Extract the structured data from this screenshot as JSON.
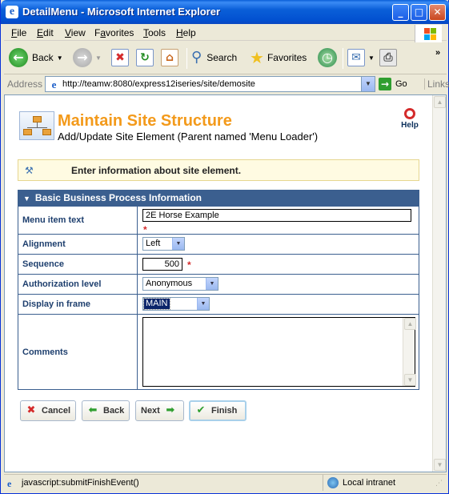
{
  "window": {
    "title": "DetailMenu - Microsoft Internet Explorer",
    "minimize": "_",
    "maximize": "□",
    "close": "✕"
  },
  "menubar": {
    "items": [
      {
        "label_u": "F",
        "label_rest": "ile"
      },
      {
        "label_u": "E",
        "label_rest": "dit"
      },
      {
        "label_u": "V",
        "label_rest": "iew"
      },
      {
        "label_u": "",
        "label_pre": "F",
        "label_u2": "a",
        "label_rest": "vorites"
      },
      {
        "label_u": "T",
        "label_rest": "ools"
      },
      {
        "label_u": "H",
        "label_rest": "elp"
      }
    ]
  },
  "toolbar": {
    "back": "Back",
    "search": "Search",
    "favorites": "Favorites"
  },
  "address": {
    "label": "Address",
    "url": "http://teamw:8080/express12iseries/site/demosite",
    "go": "Go",
    "links": "Links"
  },
  "page": {
    "title": "Maintain Site Structure",
    "subtitle": "Add/Update Site Element (Parent named 'Menu Loader')",
    "help": "Help",
    "info": "Enter information about site element.",
    "section_title": "Basic Business Process Information",
    "fields": {
      "menu_item_text": {
        "label": "Menu item text",
        "value": "2E Horse Example"
      },
      "alignment": {
        "label": "Alignment",
        "value": "Left"
      },
      "sequence": {
        "label": "Sequence",
        "value": "500"
      },
      "authorization": {
        "label": "Authorization level",
        "value": "Anonymous"
      },
      "display_frame": {
        "label": "Display in frame",
        "value": "MAIN"
      },
      "comments": {
        "label": "Comments",
        "value": ""
      }
    },
    "required_mark": "*",
    "buttons": {
      "cancel": "Cancel",
      "back": "Back",
      "next": "Next",
      "finish": "Finish"
    }
  },
  "statusbar": {
    "text": "javascript:submitFinishEvent()",
    "zone": "Local intranet"
  }
}
